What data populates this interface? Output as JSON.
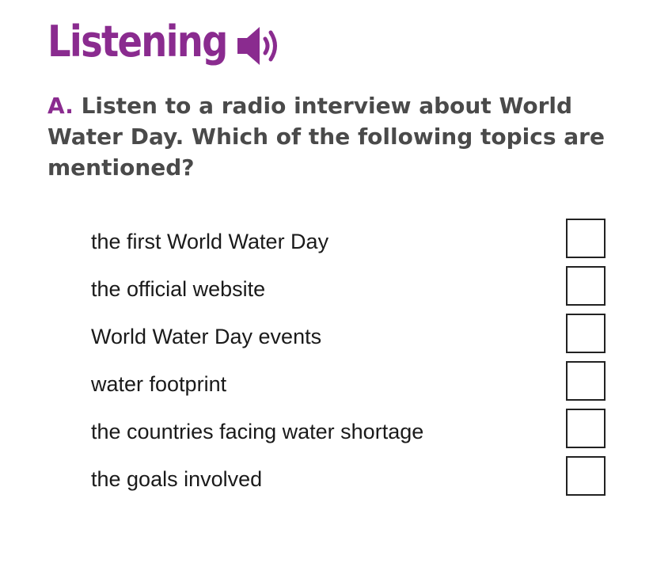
{
  "header": {
    "title": "Listening",
    "icon": "speaker-icon",
    "accent_color": "#8a2b8f"
  },
  "instruction": {
    "letter": "A.",
    "text": " Listen to a radio interview about World Water Day. Which of the following topics are mentioned?"
  },
  "topics": [
    {
      "label": "the first World Water Day",
      "checked": false
    },
    {
      "label": "the official website",
      "checked": false
    },
    {
      "label": "World Water Day events",
      "checked": false
    },
    {
      "label": "water footprint",
      "checked": false
    },
    {
      "label": "the countries facing water shortage",
      "checked": false
    },
    {
      "label": "the goals involved",
      "checked": false
    }
  ]
}
